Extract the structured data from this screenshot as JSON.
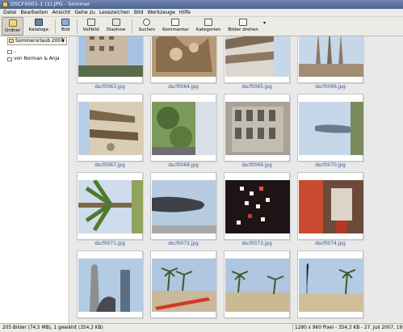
{
  "window": {
    "title": "DSCF0001-1 (1).JPG - Sommer"
  },
  "menu": [
    "Datei",
    "Bearbeiten",
    "Ansicht",
    "Gehe zu",
    "Lesezeichen",
    "Bild",
    "Werkzeuge",
    "Hilfe"
  ],
  "toolbar": {
    "folders": "Ordner",
    "catalogs": "Kataloge",
    "image": "Bild",
    "fullscreen": "Vollbild",
    "slideshow": "Diashow",
    "search": "Suchen",
    "comment": "Kommentar",
    "categories": "Kategorien",
    "rotate": "Bilder drehen",
    "more_arrow": "▾"
  },
  "sidebar": {
    "location": "Sommerurlaub 2007",
    "tree": [
      "..",
      "von Norman & Anja"
    ]
  },
  "gallery": [
    {
      "filename": "dscf0063.jpg",
      "scene": "building"
    },
    {
      "filename": "dscf0064.jpg",
      "scene": "sculpture"
    },
    {
      "filename": "dscf0065.jpg",
      "scene": "towers-rotated"
    },
    {
      "filename": "dscf0066.jpg",
      "scene": "towers"
    },
    {
      "filename": "dscf0067.jpg",
      "scene": "cathedral-rotated"
    },
    {
      "filename": "dscf0068.jpg",
      "scene": "trees-rotated"
    },
    {
      "filename": "dscf0069.jpg",
      "scene": "facade"
    },
    {
      "filename": "dscf0070.jpg",
      "scene": "tower-sky-rotated"
    },
    {
      "filename": "dscf0071.jpg",
      "scene": "palm-rotated"
    },
    {
      "filename": "dscf0072.jpg",
      "scene": "sculpture-sky"
    },
    {
      "filename": "dscf0073.jpg",
      "scene": "lights-dark"
    },
    {
      "filename": "dscf0074.jpg",
      "scene": "red-room-rotated"
    },
    {
      "filename": "",
      "scene": "skyscrapers"
    },
    {
      "filename": "",
      "scene": "beach-palms-red"
    },
    {
      "filename": "",
      "scene": "beach-palms"
    },
    {
      "filename": "",
      "scene": "beach-palms-2"
    }
  ],
  "status": {
    "left": "205 Bilder (74,5 MB), 1 gewählt (354,3 KB)",
    "right": "1280 x 960 Pixel - 354,3 KB - 27. Juli 2007, 19:54"
  }
}
